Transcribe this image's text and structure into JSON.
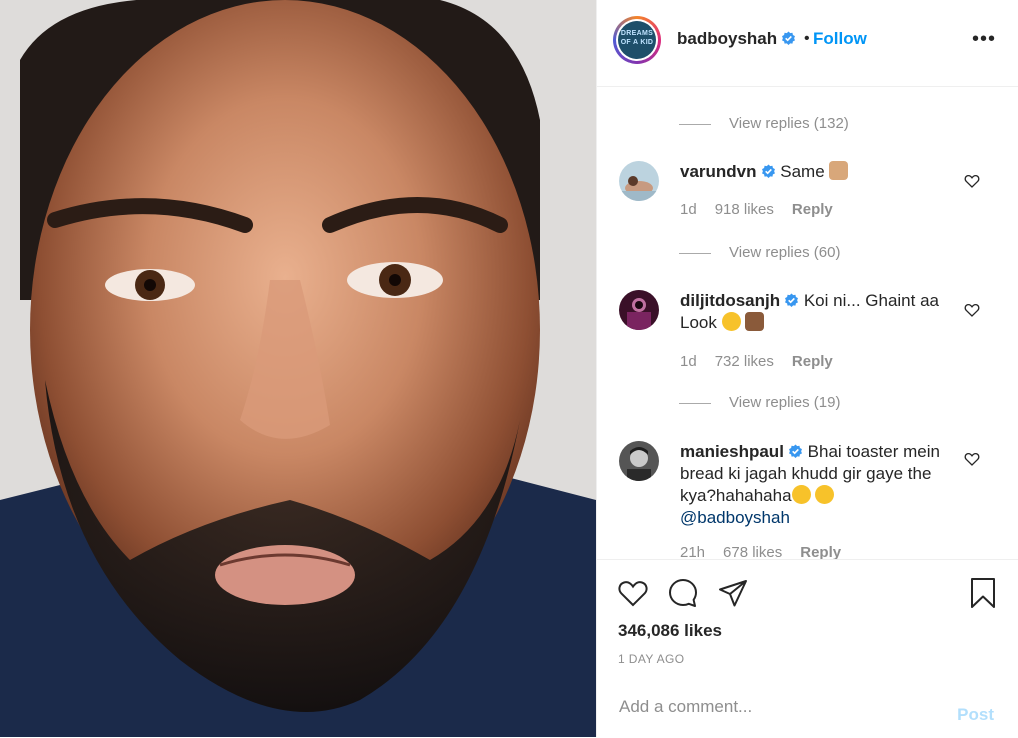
{
  "header": {
    "username": "badboyshah",
    "dot": "•",
    "follow": "Follow",
    "more": "•••"
  },
  "avatar_text": "DREAMS OF A KID",
  "comments": {
    "replies_1": "View replies (132)",
    "c1": {
      "username": "varundvn",
      "text": "Same",
      "time": "1d",
      "likes": "918 likes",
      "reply": "Reply"
    },
    "replies_2": "View replies (60)",
    "c2": {
      "username": "diljitdosanjh",
      "text": "Koi ni... Ghaint aa Look",
      "time": "1d",
      "likes": "732 likes",
      "reply": "Reply"
    },
    "replies_3": "View replies (19)",
    "c3": {
      "username": "manieshpaul",
      "text": "Bhai toaster mein bread ki jagah khudd gir gaye the kya?hahahaha",
      "mention": "@badboyshah",
      "time": "21h",
      "likes": "678 likes",
      "reply": "Reply"
    }
  },
  "actions": {
    "likes": "346,086 likes",
    "date": "1 DAY AGO"
  },
  "add_comment": {
    "placeholder": "Add a comment...",
    "post": "Post"
  },
  "colors": {
    "link": "#0095f6",
    "muted": "#8e8e8e",
    "verified": "#3897f0"
  }
}
